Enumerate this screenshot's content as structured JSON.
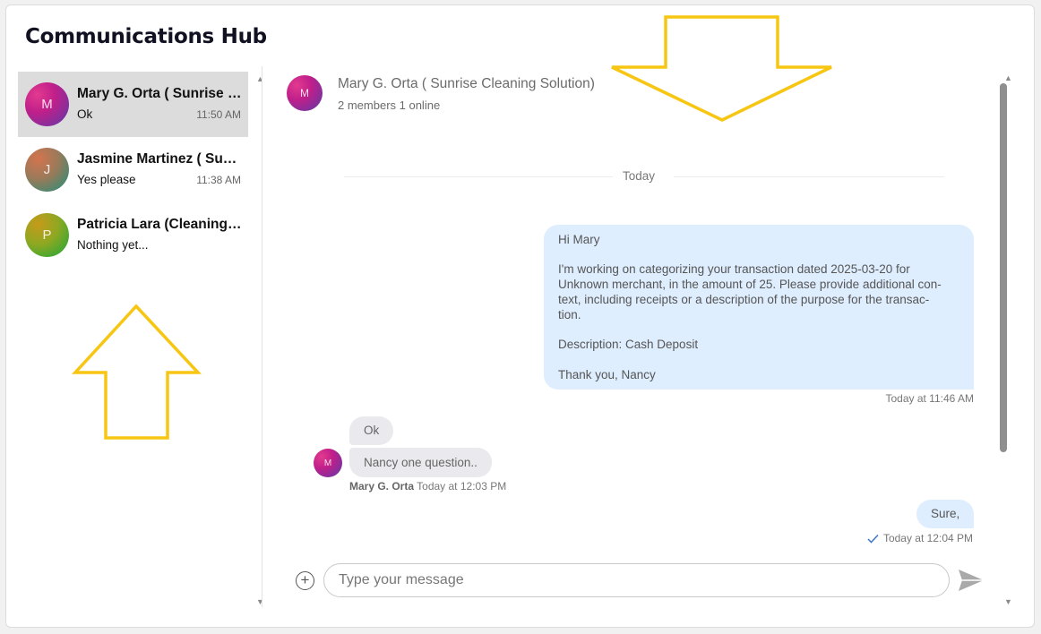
{
  "app": {
    "title": "Communications Hub"
  },
  "conversations": [
    {
      "initial": "M",
      "name": "Mary G. Orta ( Sunrise Cleaning Solution)",
      "preview": "Ok",
      "time": "11:50 AM",
      "active": true
    },
    {
      "initial": "J",
      "name": "Jasmine Martinez ( Sunrise Cleaning Solution)",
      "preview": "Yes please",
      "time": "11:38 AM",
      "active": false
    },
    {
      "initial": "P",
      "name": "Patricia Lara (Cleaning Solution)",
      "preview": "Nothing yet...",
      "time": "",
      "active": false
    }
  ],
  "chat": {
    "avatar_initial": "M",
    "title": "Mary G. Orta ( Sunrise Cleaning Solution)",
    "subtitle": "2 members 1 online",
    "day_separator": "Today",
    "messages": {
      "m1": {
        "greeting": "Hi Mary",
        "body_line1": "I'm working on categorizing your transaction dated 2025-03-20 for",
        "body_line2": "Unknown merchant, in the amount of 25. Please provide additional con-",
        "body_line3": "text, including receipts or a description of the purpose for the transac-",
        "body_line4": "tion.",
        "description": "Description: Cash Deposit",
        "signoff": "Thank you, Nancy",
        "timestamp": "Today at 11:46 AM"
      },
      "m2": {
        "text": "Ok"
      },
      "m3": {
        "text": "Nancy one question..",
        "sender": "Mary G. Orta",
        "timestamp": "Today at 12:03 PM",
        "avatar_initial": "M"
      },
      "m4": {
        "text": "Sure,",
        "timestamp": "Today at 12:04 PM",
        "status_icon": "check-icon"
      }
    }
  },
  "composer": {
    "placeholder": "Type your message",
    "value": ""
  },
  "icons": {
    "add": "plus-circle-icon",
    "send": "send-icon",
    "scroll_up": "triangle-up-icon",
    "scroll_down": "triangle-down-icon"
  },
  "colors": {
    "active_row": "#dcdcdc",
    "outgoing_bubble": "#dfeeff",
    "incoming_bubble": "#e9e9ee",
    "annotation_arrow": "#f7c613",
    "read_check": "#3f78c8"
  }
}
